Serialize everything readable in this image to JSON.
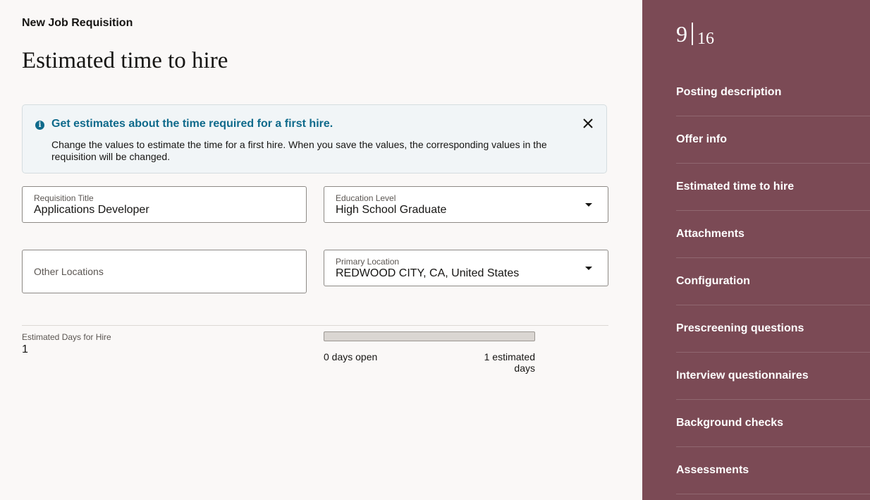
{
  "header": {
    "eyebrow": "New Job Requisition",
    "title": "Estimated time to hire"
  },
  "banner": {
    "icon": "info-icon",
    "title": "Get estimates about the time required for a first hire.",
    "text": "Change the values to estimate the time for a first hire. When you save the values, the corresponding values in the requisition will be changed."
  },
  "form": {
    "requisition_title": {
      "label": "Requisition Title",
      "value": "Applications Developer"
    },
    "education_level": {
      "label": "Education Level",
      "value": "High School Graduate"
    },
    "other_locations": {
      "placeholder": "Other Locations"
    },
    "primary_location": {
      "label": "Primary Location",
      "value": "REDWOOD CITY, CA, United States"
    }
  },
  "estimate": {
    "label": "Estimated Days for Hire",
    "value": "1",
    "days_open_text": "0 days open",
    "estimated_days_text": "1 estimated days",
    "progress_fraction": 0
  },
  "sidebar": {
    "current_step": "9",
    "total_steps": "16",
    "items": [
      {
        "label": "Posting description"
      },
      {
        "label": "Offer info"
      },
      {
        "label": "Estimated time to hire"
      },
      {
        "label": "Attachments"
      },
      {
        "label": "Configuration"
      },
      {
        "label": "Prescreening questions"
      },
      {
        "label": "Interview questionnaires"
      },
      {
        "label": "Background checks"
      },
      {
        "label": "Assessments"
      }
    ]
  },
  "colors": {
    "accent": "#0f6a8b",
    "sidebar_bg": "#7b4a55",
    "page_bg": "#faf8f7"
  }
}
